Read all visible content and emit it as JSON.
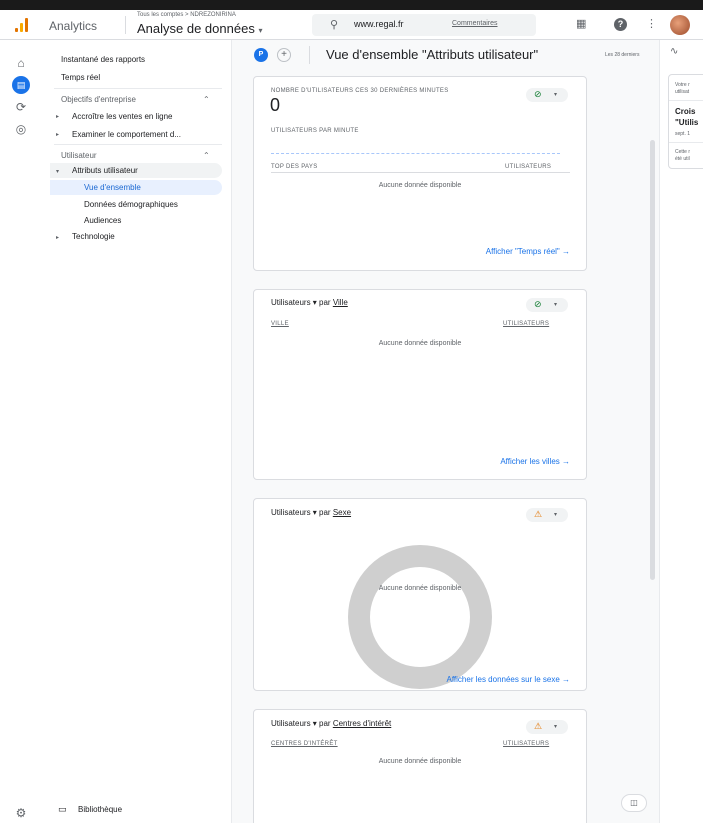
{
  "header": {
    "app_name": "Analytics",
    "breadcrumb": "Tous les comptes > NDREZONIRINA",
    "account": "Analyse de données",
    "account_caret": "▾",
    "search_text": "www.regal.fr",
    "search_link": "Commentaires"
  },
  "nav": {
    "snapshot": "Instantané des rapports",
    "realtime": "Temps réel",
    "section_business": "Objectifs d'entreprise",
    "grow_sales": "Accroître les ventes en ligne",
    "examine_behavior": "Examiner le comportement d...",
    "section_user": "Utilisateur",
    "user_attributes": "Attributs utilisateur",
    "overview": "Vue d'ensemble",
    "demographics": "Données démographiques",
    "audiences": "Audiences",
    "technology": "Technologie",
    "library": "Bibliothèque"
  },
  "main": {
    "badge": "P",
    "add": "+",
    "title": "Vue d'ensemble \"Attributs utilisateur\"",
    "date_range": "Les 28 derniers"
  },
  "cards": {
    "realtime": {
      "label": "NOMBRE D'UTILISATEURS CES 30 DERNIÈRES MINUTES",
      "value": "0",
      "per_minute": "UTILISATEURS PAR MINUTE",
      "col_left": "TOP DES PAYS",
      "col_right": "UTILISATEURS",
      "no_data": "Aucune donnée disponible",
      "link": "Afficher \"Temps réel\"  →"
    },
    "city": {
      "prefix": "Utilisateurs ▾  par ",
      "dimension": "Ville",
      "col_left": "VILLE",
      "col_right": "UTILISATEURS",
      "no_data": "Aucune donnée disponible",
      "link": "Afficher les villes  →"
    },
    "gender": {
      "prefix": "Utilisateurs ▾  par ",
      "dimension": "Sexe",
      "no_data": "Aucune donnée disponible",
      "link": "Afficher les données sur le sexe  →"
    },
    "interests": {
      "prefix": "Utilisateurs ▾  par ",
      "dimension": "Centres d'intérêt",
      "col_left": "CENTRES D'INTÉRÊT",
      "col_right": "UTILISATEURS",
      "no_data": "Aucune donnée disponible"
    }
  },
  "insights": {
    "line1": "Votre r",
    "line2": "utilisat",
    "title1": "Crois",
    "title2": "\"Utilis",
    "date": "sept. 1",
    "foot1": "Cette r",
    "foot2": "été util"
  },
  "colors": {
    "accent": "#1a73e8",
    "ok": "#188038",
    "warn": "#e37400"
  }
}
